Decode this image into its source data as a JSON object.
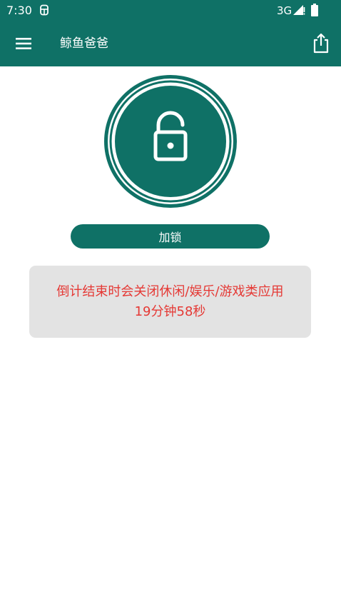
{
  "status_bar": {
    "time": "7:30",
    "network": "3G",
    "app_icon": "notification-app-icon",
    "signal_icon": "signal-icon",
    "battery_icon": "battery-icon"
  },
  "app_bar": {
    "title": "鲸鱼爸爸",
    "menu_icon": "menu-icon",
    "share_icon": "share-icon"
  },
  "lock": {
    "state_icon": "unlocked-padlock-icon",
    "button_label": "加锁"
  },
  "info": {
    "message": "倒计结束时会关闭休闲/娱乐/游戏类应用",
    "countdown": "19分钟58秒"
  },
  "colors": {
    "primary": "#0f7166",
    "card_background": "#e3e3e3",
    "message_text": "#e53935"
  }
}
